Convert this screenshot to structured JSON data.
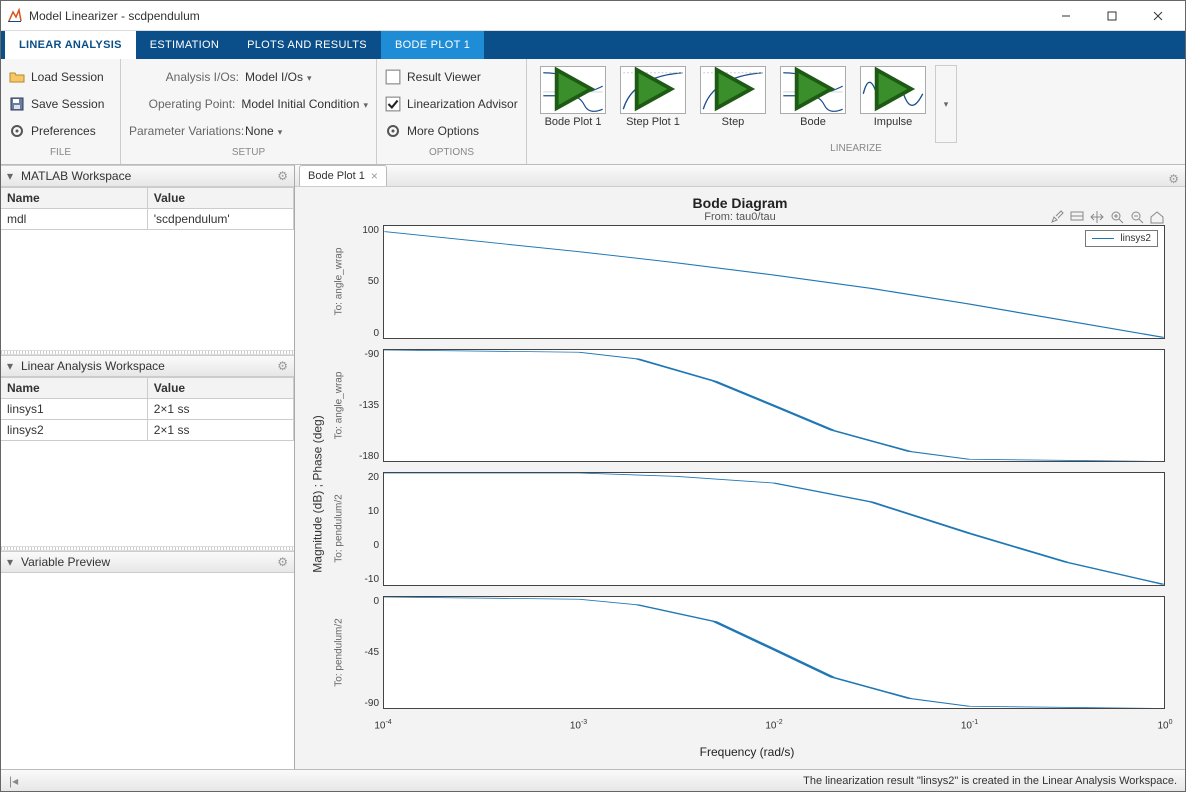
{
  "window": {
    "title": "Model Linearizer - scdpendulum"
  },
  "tabs": {
    "linear_analysis": "LINEAR ANALYSIS",
    "estimation": "ESTIMATION",
    "plots_results": "PLOTS AND RESULTS",
    "bode_plot_1": "BODE PLOT 1"
  },
  "file_group": {
    "load": "Load Session",
    "save": "Save Session",
    "prefs": "Preferences",
    "footer": "FILE"
  },
  "setup_group": {
    "io_label": "Analysis I/Os:",
    "io_value": "Model I/Os",
    "op_label": "Operating Point:",
    "op_value": "Model Initial Condition",
    "pv_label": "Parameter Variations:",
    "pv_value": "None",
    "footer": "SETUP"
  },
  "options_group": {
    "result_viewer": "Result Viewer",
    "lin_advisor": "Linearization Advisor",
    "more_options": "More Options",
    "footer": "OPTIONS"
  },
  "linearize_group": {
    "items": [
      {
        "label": "Bode Plot 1"
      },
      {
        "label": "Step Plot 1"
      },
      {
        "label": "Step"
      },
      {
        "label": "Bode"
      },
      {
        "label": "Impulse"
      }
    ],
    "footer": "LINEARIZE"
  },
  "matlab_ws": {
    "title": "MATLAB Workspace",
    "columns": {
      "name": "Name",
      "value": "Value"
    },
    "rows": [
      {
        "name": "mdl",
        "value": "'scdpendulum'"
      }
    ]
  },
  "linear_ws": {
    "title": "Linear Analysis Workspace",
    "columns": {
      "name": "Name",
      "value": "Value"
    },
    "rows": [
      {
        "name": "linsys1",
        "value": "2×1 ss"
      },
      {
        "name": "linsys2",
        "value": "2×1 ss"
      }
    ]
  },
  "var_preview": {
    "title": "Variable Preview"
  },
  "doc_tab": {
    "label": "Bode Plot 1"
  },
  "plot": {
    "title": "Bode Diagram",
    "subtitle": "From: tau0/tau",
    "ylabel": "Magnitude (dB) ; Phase (deg)",
    "xlabel": "Frequency  (rad/s)",
    "legend": "linsys2",
    "sub_ylabels": {
      "s1": "To: angle_wrap",
      "s2": "To: angle_wrap",
      "s3": "To: pendulum/2",
      "s4": "To: pendulum/2"
    },
    "yticks": {
      "s1": [
        "100",
        "50",
        "0"
      ],
      "s2": [
        "-90",
        "-135",
        "-180"
      ],
      "s3": [
        "20",
        "10",
        "0",
        "-10"
      ],
      "s4": [
        "0",
        "-45",
        "-90"
      ]
    },
    "xticks_html": [
      "10<sup>-4</sup>",
      "10<sup>-3</sup>",
      "10<sup>-2</sup>",
      "10<sup>-1</sup>",
      "10<sup>0</sup>"
    ]
  },
  "status": {
    "text": "The linearization result \"linsys2\" is created in the Linear Analysis Workspace."
  },
  "chart_data": [
    {
      "type": "line",
      "title": "Bode Diagram — Magnitude — To: angle_wrap",
      "xlabel": "Frequency (rad/s)",
      "ylabel": "Magnitude (dB)",
      "xscale": "log",
      "xlim": [
        0.0001,
        1.0
      ],
      "ylim": [
        0,
        110
      ],
      "series": [
        {
          "name": "linsys2",
          "x": [
            0.0001,
            0.000316,
            0.001,
            0.00316,
            0.01,
            0.0316,
            0.1,
            0.316,
            1.0
          ],
          "y": [
            105,
            95,
            85,
            74,
            62,
            48,
            33,
            17,
            0
          ]
        }
      ]
    },
    {
      "type": "line",
      "title": "Bode Diagram — Phase — To: angle_wrap",
      "xlabel": "Frequency (rad/s)",
      "ylabel": "Phase (deg)",
      "xscale": "log",
      "xlim": [
        0.0001,
        1.0
      ],
      "ylim": [
        -180,
        -90
      ],
      "series": [
        {
          "name": "linsys2",
          "x": [
            0.0001,
            0.001,
            0.002,
            0.005,
            0.01,
            0.02,
            0.05,
            0.1,
            1.0
          ],
          "y": [
            -90,
            -92,
            -97,
            -115,
            -135,
            -155,
            -172,
            -178,
            -180
          ]
        }
      ]
    },
    {
      "type": "line",
      "title": "Bode Diagram — Magnitude — To: pendulum/2",
      "xlabel": "Frequency (rad/s)",
      "ylabel": "Magnitude (dB)",
      "xscale": "log",
      "xlim": [
        0.0001,
        1.0
      ],
      "ylim": [
        -10,
        25
      ],
      "series": [
        {
          "name": "linsys2",
          "x": [
            0.0001,
            0.001,
            0.00316,
            0.01,
            0.0316,
            0.1,
            0.316,
            1.0
          ],
          "y": [
            25,
            25,
            24,
            22,
            16,
            6,
            -3,
            -10
          ]
        }
      ]
    },
    {
      "type": "line",
      "title": "Bode Diagram — Phase — To: pendulum/2",
      "xlabel": "Frequency (rad/s)",
      "ylabel": "Phase (deg)",
      "xscale": "log",
      "xlim": [
        0.0001,
        1.0
      ],
      "ylim": [
        -90,
        0
      ],
      "series": [
        {
          "name": "linsys2",
          "x": [
            0.0001,
            0.001,
            0.002,
            0.005,
            0.01,
            0.02,
            0.05,
            0.1,
            1.0
          ],
          "y": [
            0,
            -2,
            -6,
            -20,
            -42,
            -65,
            -82,
            -88,
            -90
          ]
        }
      ]
    }
  ]
}
